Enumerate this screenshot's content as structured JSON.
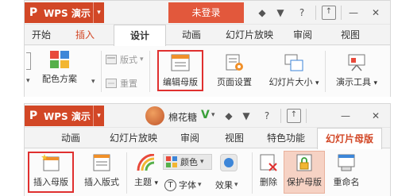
{
  "panel1": {
    "app_logo": "P",
    "app_name": "WPS 演示",
    "app_caret": "▾",
    "login_button": "未登录",
    "toolbar_icons": {
      "palette": "◆",
      "shirt": "▼",
      "help": "?",
      "minimize": "—",
      "close": "✕"
    },
    "tabs": [
      "开始",
      "插入",
      "设计",
      "动画",
      "幻灯片放映",
      "审阅",
      "视图"
    ],
    "active_tab": "设计",
    "ribbon": {
      "color_scheme": "配色方案",
      "layout": "版式",
      "reset": "重置",
      "edit_master": "编辑母版",
      "page_setup": "页面设置",
      "slide_size": "幻灯片大小",
      "presentation_tools": "演示工具"
    }
  },
  "panel2": {
    "app_logo": "P",
    "app_name": "WPS 演示",
    "app_caret": "▾",
    "username": "棉花糖",
    "vip_mark": "V",
    "toolbar_icons": {
      "palette": "◆",
      "shirt": "▼",
      "help": "?",
      "minimize": "—",
      "close": "✕"
    },
    "tabs": [
      "动画",
      "幻灯片放映",
      "审阅",
      "视图",
      "特色功能",
      "幻灯片母版"
    ],
    "active_tab": "幻灯片母版",
    "ribbon": {
      "insert_master": "插入母版",
      "insert_layout": "插入版式",
      "theme": "主题",
      "color": "颜色",
      "font": "字体",
      "effects": "效果",
      "delete": "删除",
      "protect_master": "保护母版",
      "rename": "重命名"
    }
  },
  "colors": {
    "brand": "#d24726",
    "highlight": "#e0302f",
    "active_tab_text": "#d24726"
  }
}
